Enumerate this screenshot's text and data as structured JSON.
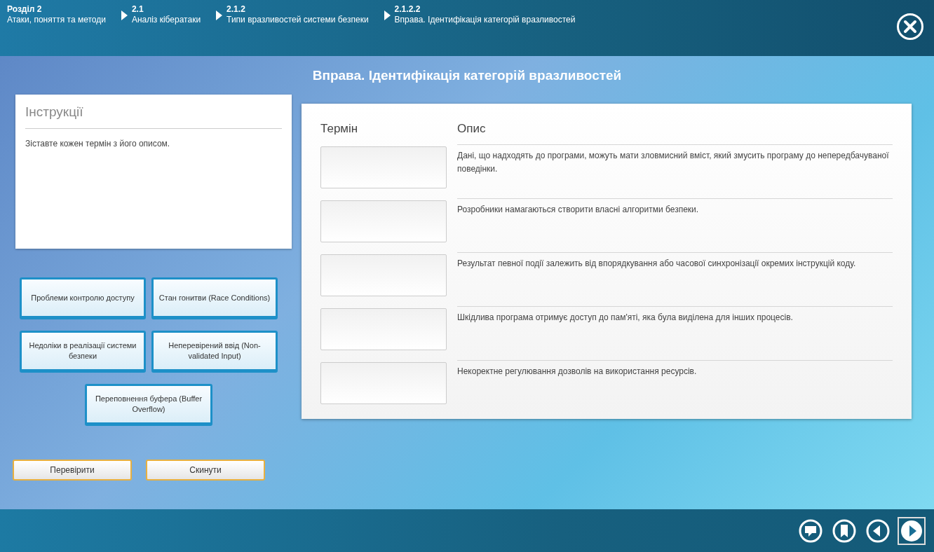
{
  "breadcrumbs": [
    {
      "number": "Розділ 2",
      "title": "Атаки, поняття та методи"
    },
    {
      "number": "2.1",
      "title": "Аналіз кібератаки"
    },
    {
      "number": "2.1.2",
      "title": "Типи вразливостей системи безпеки"
    },
    {
      "number": "2.1.2.2",
      "title": "Вправа. Ідентифікація категорій вразливостей"
    }
  ],
  "page_title": "Вправа. Ідентифікація категорій вразливостей",
  "instructions": {
    "heading": "Інструкції",
    "text": "Зіставте кожен термін з його описом."
  },
  "terms": [
    "Проблеми контролю доступу",
    "Стан гонитви (Race Conditions)",
    "Недоліки в реалізації системи безпеки",
    "Неперевірений ввід (Non-validated Input)",
    "Переповнення буфера (Buffer Overflow)"
  ],
  "actions": [
    "Перевірити",
    "Скинути"
  ],
  "table": {
    "columns": [
      "Термін",
      "Опис"
    ],
    "rows": [
      {
        "description": "Дані, що надходять до програми, можуть мати зловмисний вміст, який змусить програму до непередбачуваної поведінки."
      },
      {
        "description": "Розробники намагаються створити власні алгоритми безпеки."
      },
      {
        "description": "Результат певної події залежить від впорядкування або часової синхронізації окремих інструкцій коду."
      },
      {
        "description": "Шкідлива програма отримує доступ до пам'яті, яка була виділена для інших процесів."
      },
      {
        "description": "Некоректне регулювання дозволів на використання ресурсів."
      }
    ]
  },
  "nav": [
    {
      "kind": "comment",
      "selected": false
    },
    {
      "kind": "bookmark",
      "selected": false
    },
    {
      "kind": "back",
      "selected": false
    },
    {
      "kind": "next",
      "selected": true
    }
  ]
}
